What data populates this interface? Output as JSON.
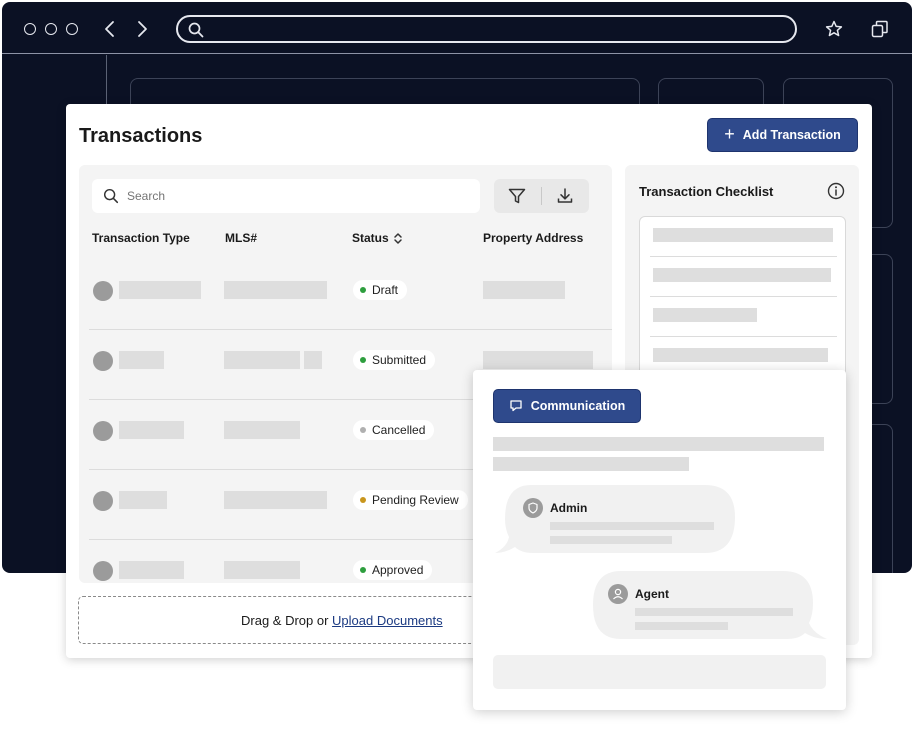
{
  "colors": {
    "browser_bg": "#0b1124",
    "primary": "#2f4a8c",
    "link": "#1b3a82",
    "status_draft": "#2e9e3e",
    "status_submitted": "#2e9e3e",
    "status_cancelled": "#b0b0b0",
    "status_pending": "#c9961d",
    "status_approved": "#2e9e3e"
  },
  "browser": {
    "icons": [
      "circle-icon",
      "circle-icon",
      "circle-icon",
      "back-icon",
      "forward-icon",
      "search-icon",
      "star-icon",
      "windows-icon"
    ]
  },
  "page": {
    "title": "Transactions",
    "add_button": "Add Transaction",
    "add_icon": "plus-icon"
  },
  "table": {
    "search_placeholder": "Search",
    "columns": [
      "Transaction Type",
      "MLS#",
      "Status",
      "Property Address"
    ],
    "sort_icon": "sort-icon",
    "tool_icons": [
      "filter-icon",
      "download-icon"
    ],
    "rows": [
      {
        "status": "Draft",
        "status_color": "#2e9e3e"
      },
      {
        "status": "Submitted",
        "status_color": "#2e9e3e"
      },
      {
        "status": "Cancelled",
        "status_color": "#b0b0b0"
      },
      {
        "status": "Pending Review",
        "status_color": "#c9961d"
      },
      {
        "status": "Approved",
        "status_color": "#2e9e3e"
      }
    ]
  },
  "dropzone": {
    "text": "Drag & Drop or ",
    "link": "Upload Documents"
  },
  "checklist": {
    "title": "Transaction Checklist",
    "info_icon": "info-icon"
  },
  "communication": {
    "button": "Communication",
    "button_icon": "chat-icon",
    "messages": [
      {
        "author": "Admin",
        "avatar_icon": "shield-icon"
      },
      {
        "author": "Agent",
        "avatar_icon": "user-icon"
      }
    ]
  }
}
